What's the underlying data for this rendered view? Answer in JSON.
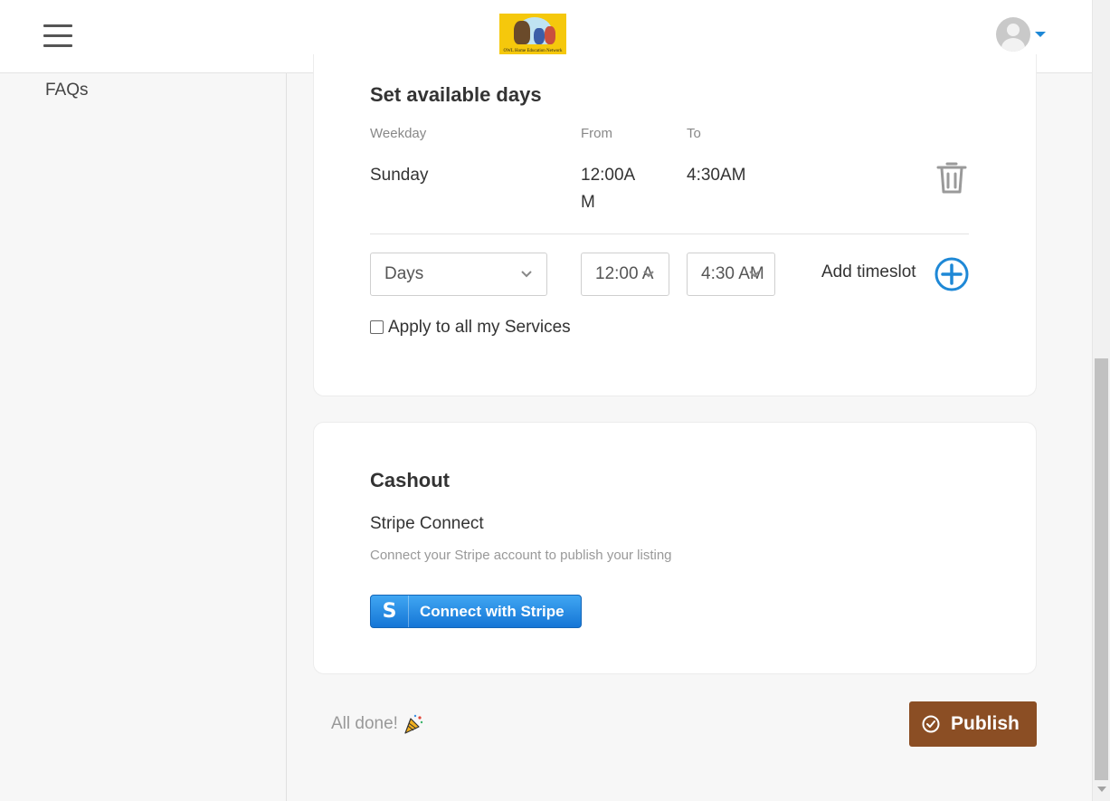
{
  "header": {
    "logo_text": "OWL Home Education Network",
    "menu_icon": "hamburger-icon",
    "avatar_icon": "user-avatar-icon"
  },
  "sidebar": {
    "items": [
      {
        "label": "FAQs"
      }
    ]
  },
  "availability": {
    "title": "Set available days",
    "columns": {
      "weekday": "Weekday",
      "from": "From",
      "to": "To"
    },
    "rows": [
      {
        "weekday": "Sunday",
        "from_line1": "12:00A",
        "from_line2": "M",
        "to": "4:30AM"
      }
    ],
    "new_slot": {
      "day_value": "Days",
      "from_value": "12:00 A",
      "to_value": "4:30 AM",
      "add_label": "Add timeslot"
    },
    "apply_all_label": "Apply to all my Services"
  },
  "cashout": {
    "title": "Cashout",
    "subtitle": "Stripe Connect",
    "description": "Connect your Stripe account to publish your listing",
    "stripe_button_icon": "S",
    "stripe_button_label": "Connect with Stripe"
  },
  "footer": {
    "done_text": "All done!",
    "publish_label": "Publish"
  },
  "colors": {
    "accent_blue": "#1e88d6",
    "publish_brown": "#8b4e24",
    "stripe_blue": "#1576d6"
  }
}
